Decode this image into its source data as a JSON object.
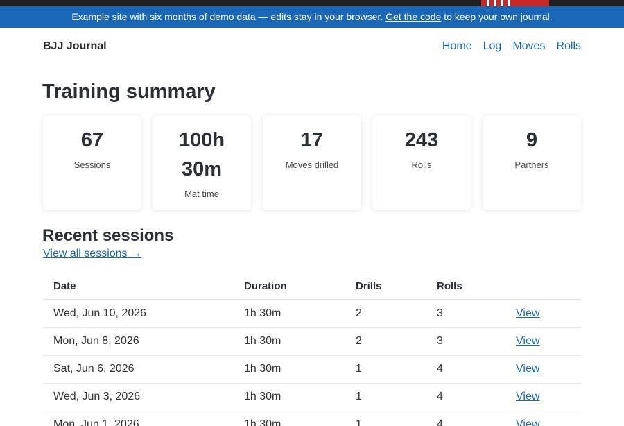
{
  "banner": {
    "text_before": "Example site with six months of demo data — edits stay in your browser.",
    "link": "Get the code",
    "text_after": "to keep your own journal."
  },
  "header": {
    "brand": "BJJ Journal",
    "nav": [
      "Home",
      "Log",
      "Moves",
      "Rolls"
    ]
  },
  "summary": {
    "title": "Training summary",
    "cards": [
      {
        "value": "67",
        "label": "Sessions"
      },
      {
        "value": "100h 30m",
        "label": "Mat time"
      },
      {
        "value": "17",
        "label": "Moves drilled"
      },
      {
        "value": "243",
        "label": "Rolls"
      },
      {
        "value": "9",
        "label": "Partners"
      }
    ]
  },
  "recent": {
    "title": "Recent sessions",
    "view_all": "View all sessions →",
    "columns": [
      "Date",
      "Duration",
      "Drills",
      "Rolls",
      ""
    ],
    "rows": [
      {
        "date": "Wed, Jun 10, 2026",
        "duration": "1h 30m",
        "drills": "2",
        "rolls": "3",
        "action": "View"
      },
      {
        "date": "Mon, Jun 8, 2026",
        "duration": "1h 30m",
        "drills": "2",
        "rolls": "3",
        "action": "View"
      },
      {
        "date": "Sat, Jun 6, 2026",
        "duration": "1h 30m",
        "drills": "1",
        "rolls": "4",
        "action": "View"
      },
      {
        "date": "Wed, Jun 3, 2026",
        "duration": "1h 30m",
        "drills": "1",
        "rolls": "4",
        "action": "View"
      },
      {
        "date": "Mon, Jun 1, 2026",
        "duration": "1h 30m",
        "drills": "1",
        "rolls": "4",
        "action": "View"
      }
    ]
  },
  "colors": {
    "accent": "#1a67b8",
    "banner_bg": "#1a67b8",
    "flag_red": "#c62828"
  }
}
